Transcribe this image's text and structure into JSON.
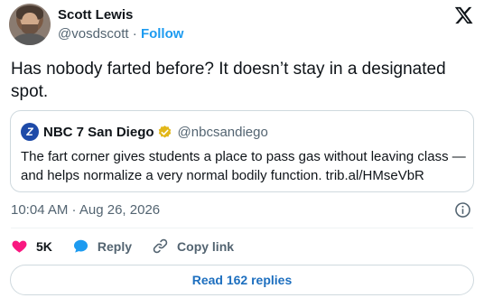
{
  "author": {
    "name": "Scott Lewis",
    "handle": "@vosdscott",
    "separator": " · ",
    "follow_label": "Follow"
  },
  "tweet": {
    "text": "Has nobody farted before? It doesn’t stay in a designated spot."
  },
  "quote": {
    "logo_text": "Z",
    "name": "NBC 7 San Diego",
    "handle": "@nbcsandiego",
    "text": "The fart corner gives students a place to pass gas without leaving class — and helps normalize a very normal bodily function. trib.al/HMseVbR"
  },
  "meta": {
    "timestamp": "10:04 AM · Aug 26, 2026"
  },
  "actions": {
    "like_count": "5K",
    "reply_label": "Reply",
    "copy_link_label": "Copy link"
  },
  "footer": {
    "read_replies_label": "Read 162 replies"
  },
  "colors": {
    "accent": "#1d9bf0",
    "like": "#f91880",
    "verified": "#e2b719",
    "muted": "#536471"
  }
}
